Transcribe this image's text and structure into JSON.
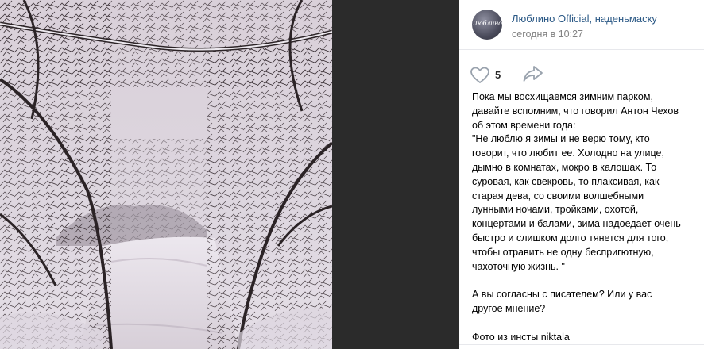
{
  "photo": {
    "alt": "Снежный парк зимой",
    "colors": {
      "sky": "#d8d0d8",
      "snow": "#e6e0e8",
      "branches": "#2b2326"
    }
  },
  "post": {
    "author": "Люблино Official, наденьмаску",
    "author_display": "Люблино Official, наденьмаску",
    "avatar_text": "Люблино",
    "time": "сегодня в 10:27",
    "likes": "5",
    "text_lines": [
      "Пока мы восхищаемся зимним парком,",
      "давайте вспомним, что говорил Антон Чехов",
      "об этом времени года:",
      "\"Не люблю я зимы и не верю тому, кто",
      "говорит, что любит ее. Холодно на улице,",
      "дымно в комнатах, мокро в калошах. То",
      "суровая, как свекровь, то плаксивая, как",
      "старая дева, со своими волшебными",
      "лунными ночами, тройками, охотой,",
      "концертами и балами, зима надоедает очень",
      "быстро и слишком долго тянется для того,",
      "чтобы отравить не одну беспригютную,",
      "чахоточную жизнь. \""
    ],
    "question_lines": [
      "А вы согласны с писателем? Или у вас",
      "другое мнение?"
    ],
    "credit": "Фото из инсты niktala"
  },
  "colors": {
    "link": "#2a5885",
    "meta": "#828282",
    "divider": "#e7e8ec",
    "icon": "#99a2ad"
  },
  "icons": {
    "like": "heart-icon",
    "share": "share-arrow-icon"
  }
}
